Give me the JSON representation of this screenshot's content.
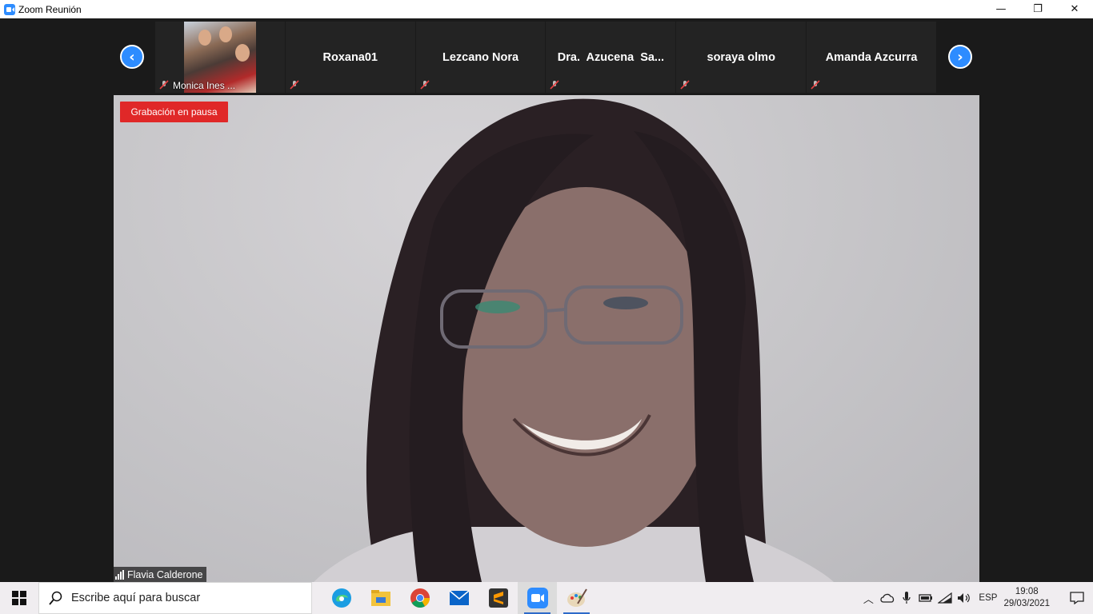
{
  "window": {
    "title": "Zoom Reunión",
    "minimize": "—",
    "restore": "❐",
    "close": "✕"
  },
  "gallery": {
    "prev_arrow": "‹",
    "next_arrow": "›",
    "participants": [
      {
        "name": "Monica Ines ..."
      },
      {
        "name": "Roxana01"
      },
      {
        "name": "Lezcano Nora"
      },
      {
        "name": "Dra.  Azucena  Sa..."
      },
      {
        "name": "soraya olmo"
      },
      {
        "name": "Amanda Azcurra"
      }
    ]
  },
  "main_video": {
    "recording_badge": "Grabación en pausa",
    "speaker_name": "Flavia Calderone"
  },
  "taskbar": {
    "search_placeholder": "Escribe aquí para buscar",
    "apps": [
      "edge-icon",
      "file-explorer-icon",
      "chrome-icon",
      "mail-icon",
      "sublime-icon",
      "zoom-icon",
      "paint-icon"
    ],
    "language": "ESP",
    "time": "19:08",
    "date": "29/03/2021"
  },
  "colors": {
    "accent": "#2d8cff",
    "recording": "#e02828",
    "meeting_bg": "#1a1a1a",
    "mute_red": "#e84040"
  }
}
